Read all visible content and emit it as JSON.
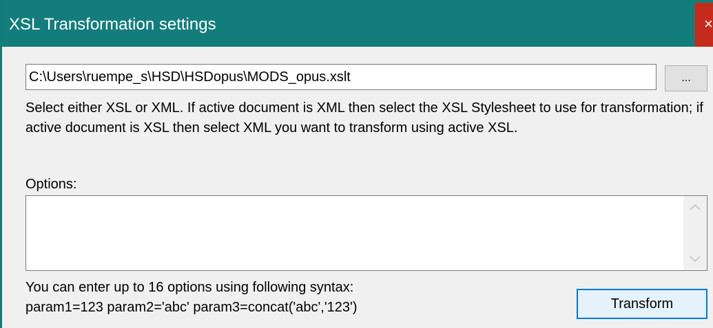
{
  "window": {
    "title": "XSL Transformation settings",
    "close_glyph": "×",
    "accent_color": "#137d7b",
    "close_color": "#c42b1c"
  },
  "file": {
    "path": "C:\\Users\\ruempe_s\\HSD\\HSDopus\\MODS_opus.xslt",
    "browse_label": "..."
  },
  "help_text": "Select either XSL or XML. If active document is XML then select the XSL Stylesheet to use for transformation; if active document is XSL then select XML you want to transform using active XSL.",
  "options": {
    "label": "Options:",
    "value": "",
    "scroll_up_icon": "chevron-up-icon",
    "scroll_down_icon": "chevron-down-icon"
  },
  "syntax": {
    "line1": "You can enter up to 16 options using following syntax:",
    "line2": "param1=123 param2='abc' param3=concat('abc','123')"
  },
  "actions": {
    "transform_label": "Transform"
  }
}
